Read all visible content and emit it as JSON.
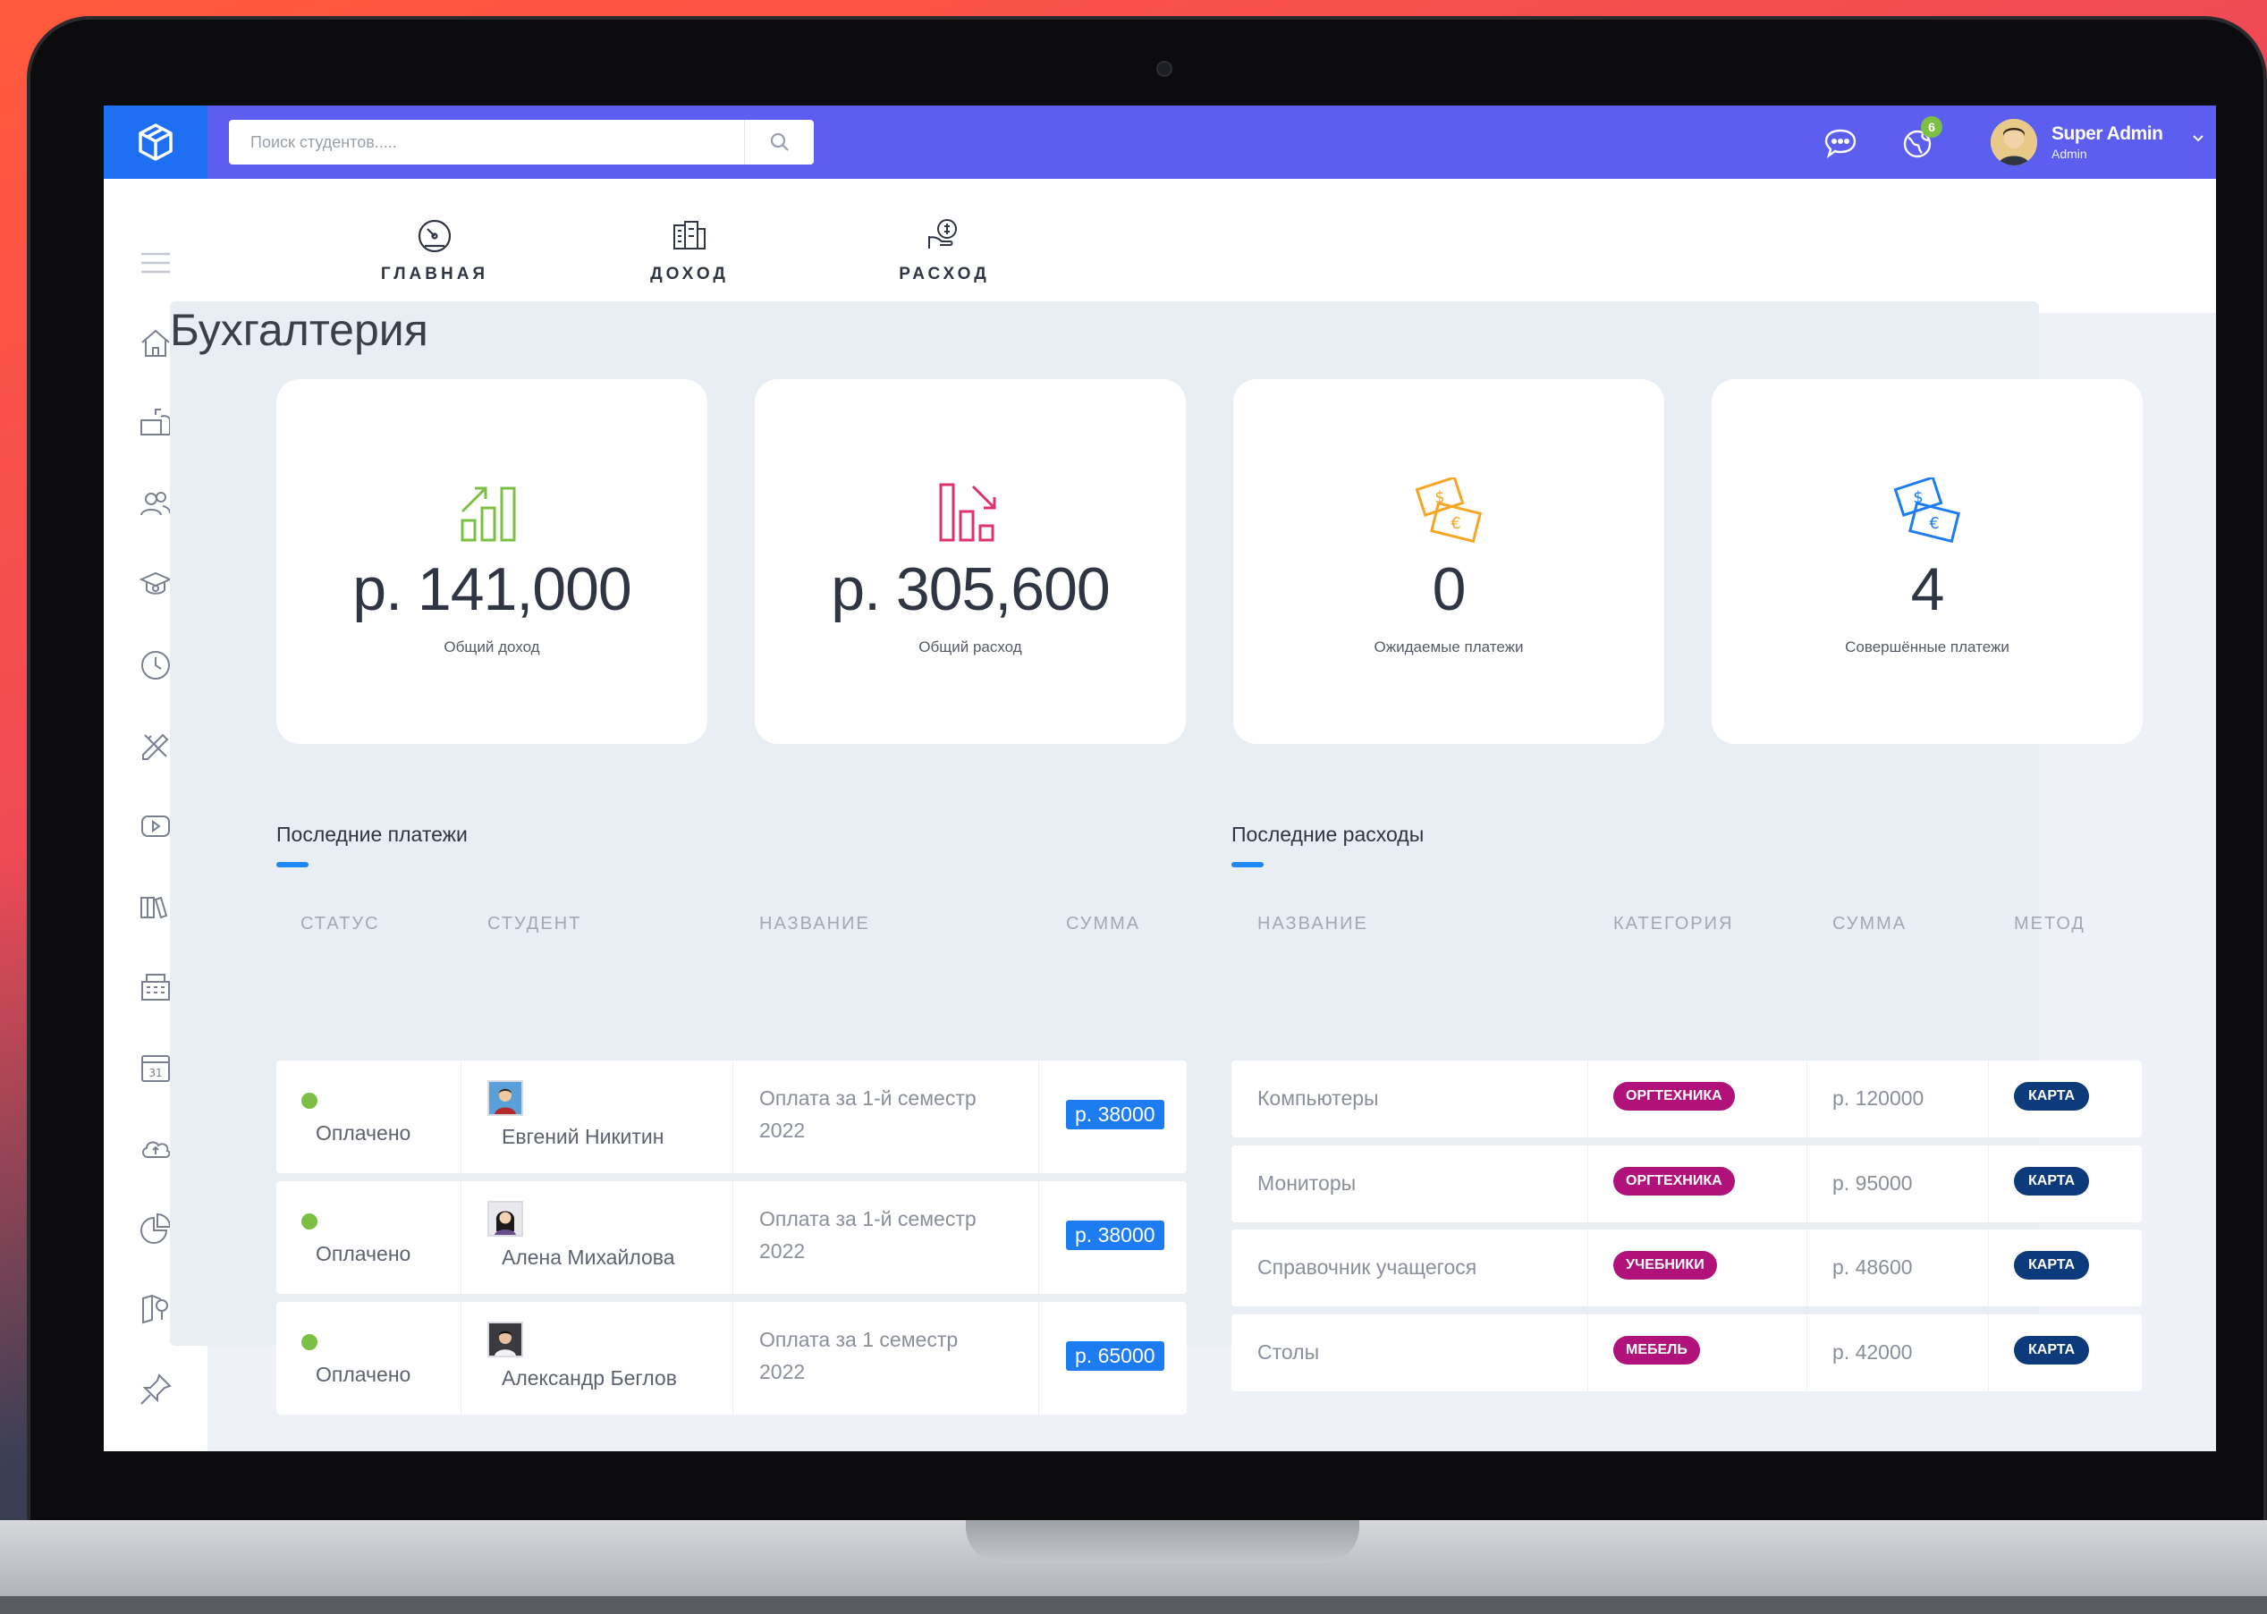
{
  "topbar": {
    "search_placeholder": "Поиск студентов.....",
    "notification_count": "6",
    "user_name": "Super Admin",
    "user_role": "Admin"
  },
  "tabs": [
    {
      "label": "ГЛАВНАЯ",
      "icon": "speedometer-icon",
      "active": true
    },
    {
      "label": "ДОХОД",
      "icon": "money-stack-icon",
      "active": false
    },
    {
      "label": "РАСХОД",
      "icon": "money-expense-icon",
      "active": false
    }
  ],
  "page_title": "Бухгалтерия",
  "stats": [
    {
      "value": "р. 141,000",
      "label": "Общий доход",
      "icon": "chart-up-icon",
      "color": "#7bc043"
    },
    {
      "value": "р. 305,600",
      "label": "Общий расход",
      "icon": "chart-down-icon",
      "color": "#e0316f"
    },
    {
      "value": "0",
      "label": "Ожидаемые платежи",
      "icon": "banknotes-icon",
      "color": "#f5a623"
    },
    {
      "value": "4",
      "label": "Совершённые платежи",
      "icon": "banknotes-icon",
      "color": "#1e7cf2"
    }
  ],
  "payments": {
    "title": "Последние платежи",
    "headers": [
      "СТАТУС",
      "СТУДЕНТ",
      "НАЗВАНИЕ",
      "СУММА"
    ],
    "rows": [
      {
        "status": "Оплачено",
        "student": "Евгений Никитин",
        "name_line1": "Оплата за 1-й семестр",
        "name_line2": "2022",
        "amount": "р. 38000"
      },
      {
        "status": "Оплачено",
        "student": "Алена Михайлова",
        "name_line1": "Оплата за 1-й семестр",
        "name_line2": "2022",
        "amount": "р. 38000"
      },
      {
        "status": "Оплачено",
        "student": "Александр Беглов",
        "name_line1": "Оплата за 1 семестр",
        "name_line2": "2022",
        "amount": "р. 65000"
      }
    ]
  },
  "expenses": {
    "title": "Последние расходы",
    "headers": [
      "НАЗВАНИЕ",
      "КАТЕГОРИЯ",
      "СУММА",
      "МЕТОД"
    ],
    "rows": [
      {
        "name": "Компьютеры",
        "category": "ОРГТЕХНИКА",
        "amount": "р. 120000",
        "method": "КАРТА"
      },
      {
        "name": "Мониторы",
        "category": "ОРГТЕХНИКА",
        "amount": "р. 95000",
        "method": "КАРТА"
      },
      {
        "name": "Справочник учащегося",
        "category": "УЧЕБНИКИ",
        "amount": "р. 48600",
        "method": "КАРТА"
      },
      {
        "name": "Столы",
        "category": "МЕБЕЛЬ",
        "amount": "р. 42000",
        "method": "КАРТА"
      }
    ]
  },
  "sidebar_icons": [
    "menu-icon",
    "home-icon",
    "mailbox-icon",
    "users-icon",
    "graduation-cap-icon",
    "clock-icon",
    "pencil-ruler-icon",
    "video-icon",
    "books-icon",
    "buildings-icon",
    "calendar-icon",
    "cloud-icon",
    "pie-chart-icon",
    "map-icon",
    "pin-icon"
  ]
}
